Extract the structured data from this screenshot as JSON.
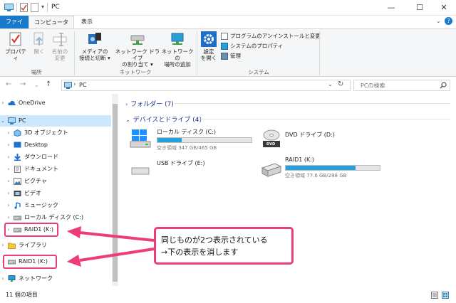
{
  "window": {
    "title": "PC",
    "controls": {
      "minimize": "—",
      "maximize": "☐",
      "close": "✕"
    },
    "help": "?"
  },
  "ribbon": {
    "tabs": {
      "file": "ファイル",
      "computer": "コンピューター",
      "view": "表示"
    },
    "location_group": {
      "label": "場所",
      "properties": "プロパティ",
      "open": "開く",
      "rename_l1": "名前の",
      "rename_l2": "変更"
    },
    "network_group": {
      "label": "ネットワーク",
      "media_l1": "メディアの",
      "media_l2": "接続と切断 ▾",
      "map_l1": "ネットワーク ドライブ",
      "map_l2": "の割り当て ▾",
      "addloc_l1": "ネットワークの",
      "addloc_l2": "場所の追加"
    },
    "system_group": {
      "label": "システム",
      "settings_l1": "設定",
      "settings_l2": "を開く",
      "uninstall": "プログラムのアンインストールと変更",
      "sysprops": "システムのプロパティ",
      "manage": "管理"
    }
  },
  "addressbar": {
    "path": "PC",
    "search_placeholder": "PCの検索",
    "chevron": "›",
    "dropdown": "⌄",
    "refresh": "↻",
    "back": "←",
    "forward": "→",
    "recent": "⌄",
    "up": "↑"
  },
  "nav": {
    "items": [
      {
        "label": "OneDrive"
      },
      {
        "label": "PC"
      },
      {
        "label": "3D オブジェクト"
      },
      {
        "label": "Desktop"
      },
      {
        "label": "ダウンロード"
      },
      {
        "label": "ドキュメント"
      },
      {
        "label": "ピクチャ"
      },
      {
        "label": "ビデオ"
      },
      {
        "label": "ミュージック"
      },
      {
        "label": "ローカル ディスク (C:)"
      },
      {
        "label": "RAID1 (K:)"
      },
      {
        "label": "ライブラリ"
      },
      {
        "label": "RAID1 (K:)"
      },
      {
        "label": "ネットワーク"
      }
    ]
  },
  "content": {
    "folders_header": "フォルダー (7)",
    "drives_header": "デバイスとドライブ (4)",
    "drives": [
      {
        "name": "ローカル ディスク (C:)",
        "free": "空き領域 347 GB/465 GB",
        "used_fraction": 0.254
      },
      {
        "name": "DVD ドライブ (D:)",
        "free": ""
      },
      {
        "name": "USB ドライブ (E:)",
        "free": ""
      },
      {
        "name": "RAID1 (K:)",
        "free": "空き領域 77.6 GB/298 GB",
        "used_fraction": 0.74
      }
    ],
    "dvd_label": "DVD"
  },
  "annotation": {
    "line1": "同じものが2つ表示されている",
    "line2": "→下の表示を消します",
    "color": "#ec3d79"
  },
  "status": {
    "count": "11 個の項目"
  },
  "colors": {
    "accent": "#1979ca",
    "selection": "#cce8ff",
    "drive_bar": "#26a0da"
  }
}
